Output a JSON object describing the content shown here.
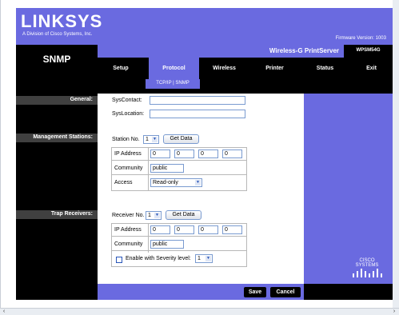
{
  "header": {
    "logo": "LINKSYS",
    "logo_sub": "A Division of Cisco Systems, Inc.",
    "firmware": "Firmware Version: 1003"
  },
  "page_title": "SNMP",
  "product": {
    "name": "Wireless-G PrintServer",
    "model": "WPSM54G"
  },
  "nav": {
    "tabs": [
      "Setup",
      "Protocol",
      "Wireless",
      "Printer",
      "Status",
      "Exit"
    ],
    "active": "Protocol",
    "subnav": "TCP/IP  |  SNMP"
  },
  "sections": {
    "general": "General:",
    "management": "Management Stations:",
    "trap": "Trap Receivers:"
  },
  "general": {
    "syscontact_label": "SysContact:",
    "syscontact_value": "",
    "syslocation_label": "SysLocation:",
    "syslocation_value": ""
  },
  "management": {
    "station_label": "Station No.",
    "station_value": "1",
    "get_data": "Get Data",
    "ip_label": "IP Address",
    "ip": [
      "0",
      "0",
      "0",
      "0"
    ],
    "community_label": "Community",
    "community_value": "public",
    "access_label": "Access",
    "access_value": "Read-only"
  },
  "trap": {
    "receiver_label": "Receiver No.",
    "receiver_value": "1",
    "get_data": "Get Data",
    "ip_label": "IP Address",
    "ip": [
      "0",
      "0",
      "0",
      "0"
    ],
    "community_label": "Community",
    "community_value": "public",
    "severity_label": "Enable with Severity level:",
    "severity_value": "1"
  },
  "footer": {
    "save": "Save",
    "cancel": "Cancel"
  },
  "cisco": "CISCO SYSTEMS",
  "colors": {
    "brand": "#6a6ae0",
    "dark": "#000000"
  }
}
